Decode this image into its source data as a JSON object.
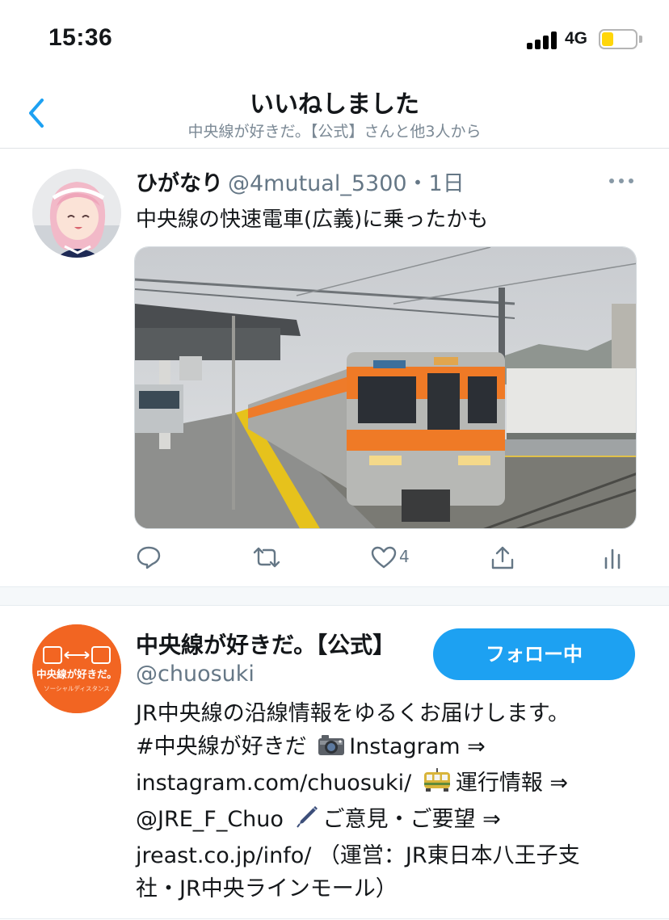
{
  "status_bar": {
    "time": "15:36",
    "network": "4G",
    "battery_level": 0.35,
    "battery_color": "#ffd60a"
  },
  "nav": {
    "title": "いいねしました",
    "subtitle": "中央線が好きだ。【公式】さんと他3人から"
  },
  "tweet": {
    "author_name": "ひがなり",
    "handle_time": "@4mutual_5300・1日",
    "text": "中央線の快速電車(広義)に乗ったかも",
    "like_count": "4"
  },
  "profile": {
    "name": "中央線が好きだ。【公式】",
    "handle": "@chuosuki",
    "follow_label": "フォロー中",
    "avatar_text": "中央線が好きだ。",
    "avatar_subtext": "ソーシャルディスタンス",
    "bio": {
      "line1": "JR中央線の沿線情報をゆるくお届けします。",
      "line2a": "#中央線が好きだ ",
      "line2b": "Instagram ⇒",
      "line3a": "instagram.com/chuosuki/ ",
      "line3b": "運行情報 ⇒",
      "line4a": "@JRE_F_Chuo ",
      "line4b": "ご意見・ご要望 ⇒",
      "line5": "jreast.co.jp/info/ （運営：JR東日本八王子支",
      "line6": "社・JR中央ラインモール）"
    }
  },
  "colors": {
    "accent": "#1da1f2",
    "brand_orange": "#f26522"
  }
}
